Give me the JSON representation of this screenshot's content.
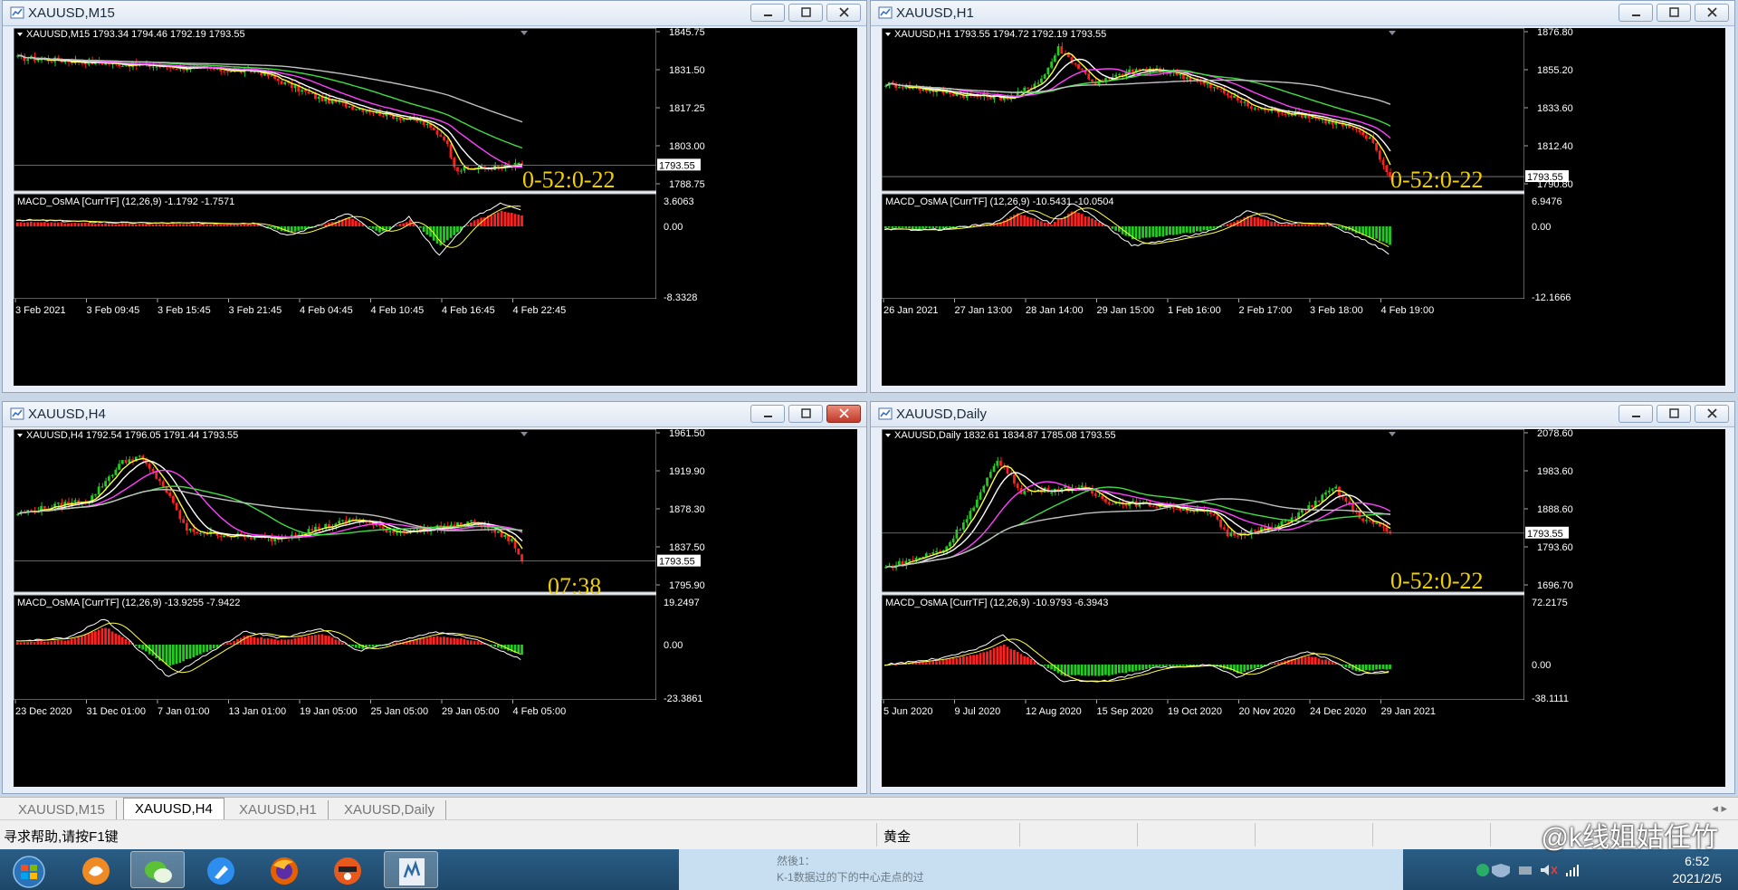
{
  "windows": [
    {
      "id": "m15",
      "title": "XAUUSD,M15",
      "header": "XAUUSD,M15  1793.34 1794.46 1792.19 1793.55",
      "price_ticks": [
        "1845.75",
        "1831.50",
        "1817.25",
        "1803.00",
        "1788.75"
      ],
      "current_price": "1793.55",
      "macd_label": "MACD_OsMA [CurrTF] (12,26,9) -1.1792 -1.7571",
      "macd_ticks": [
        "3.6063",
        "0.00",
        "-8.3328"
      ],
      "timer": "0-52:0-22",
      "time_ticks": [
        "3 Feb 2021",
        "3 Feb 09:45",
        "3 Feb 15:45",
        "3 Feb 21:45",
        "4 Feb 04:45",
        "4 Feb 10:45",
        "4 Feb 16:45",
        "4 Feb 22:45"
      ],
      "close_active": false
    },
    {
      "id": "h1",
      "title": "XAUUSD,H1",
      "header": "XAUUSD,H1  1793.55 1794.72 1792.19 1793.55",
      "price_ticks": [
        "1876.80",
        "1855.20",
        "1833.60",
        "1812.40",
        "1790.80"
      ],
      "current_price": "1793.55",
      "macd_label": "MACD_OsMA [CurrTF] (12,26,9) -10.5431 -10.0504",
      "macd_ticks": [
        "6.9476",
        "0.00",
        "-12.1666"
      ],
      "timer": "0-52:0-22",
      "time_ticks": [
        "26 Jan 2021",
        "27 Jan 13:00",
        "28 Jan 14:00",
        "29 Jan 15:00",
        "1 Feb 16:00",
        "2 Feb 17:00",
        "3 Feb 18:00",
        "4 Feb 19:00"
      ],
      "close_active": false
    },
    {
      "id": "h4",
      "title": "XAUUSD,H4",
      "header": "XAUUSD,H4  1792.54 1796.05 1791.44 1793.55",
      "price_ticks": [
        "1961.50",
        "1919.90",
        "1878.30",
        "1837.50",
        "1795.90"
      ],
      "current_price": "1793.55",
      "macd_label": "MACD_OsMA [CurrTF] (12,26,9) -13.9255 -7.9422",
      "macd_ticks": [
        "19.2497",
        "0.00",
        "-23.3861"
      ],
      "timer": "07:38",
      "time_ticks": [
        "23 Dec 2020",
        "31 Dec 01:00",
        "7 Jan 01:00",
        "13 Jan 01:00",
        "19 Jan 05:00",
        "25 Jan 05:00",
        "29 Jan 05:00",
        "4 Feb 05:00"
      ],
      "close_active": true
    },
    {
      "id": "d1",
      "title": "XAUUSD,Daily",
      "header": "XAUUSD,Daily  1832.61 1834.87 1785.08 1793.55",
      "price_ticks": [
        "2078.60",
        "1983.60",
        "1888.60",
        "1793.60",
        "1696.70"
      ],
      "current_price": "1793.55",
      "macd_label": "MACD_OsMA [CurrTF] (12,26,9) -10.9793 -6.3943",
      "macd_ticks": [
        "72.2175",
        "0.00",
        "-38.1111"
      ],
      "timer": "0-52:0-22",
      "time_ticks": [
        "5 Jun 2020",
        "9 Jul 2020",
        "12 Aug 2020",
        "15 Sep 2020",
        "19 Oct 2020",
        "20 Nov 2020",
        "24 Dec 2020",
        "29 Jan 2021"
      ],
      "close_active": false
    }
  ],
  "tabs": [
    "XAUUSD,M15",
    "XAUUSD,H4",
    "XAUUSD,H1",
    "XAUUSD,Daily"
  ],
  "active_tab": "XAUUSD,H4",
  "status": {
    "help": "寻求帮助,请按F1键",
    "symbol": "黄金"
  },
  "taskbar": {
    "time": "6:52",
    "date": "2021/2/5",
    "preview_line1": "然後1：",
    "preview_line2": "K-1数据过的下的中心走点的过"
  },
  "watermark": "@k线姐姑任竹",
  "colors": {
    "bull": "#ff2020",
    "bear": "#22cc22",
    "ma_fast": "#ffff40",
    "ma_mid": "#ff40ff",
    "ma_slow": "#40dd40",
    "ma_long": "#c0c0c0",
    "timer": "#f0d000"
  }
}
